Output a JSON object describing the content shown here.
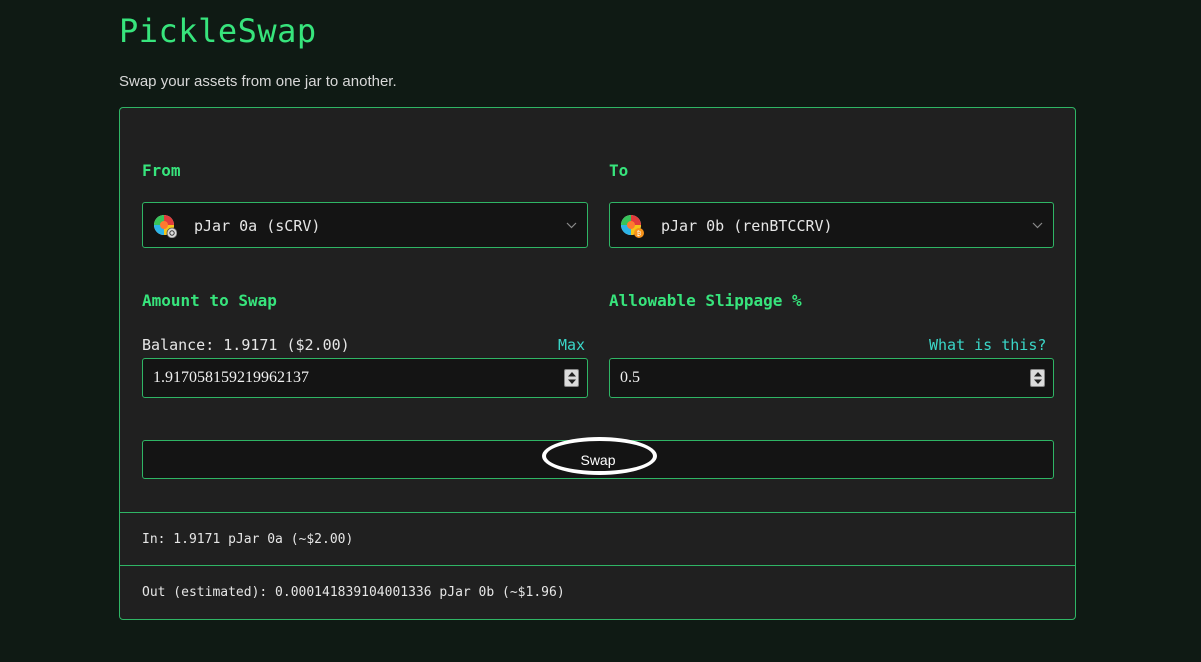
{
  "header": {
    "title": "PickleSwap",
    "subtitle": "Swap your assets from one jar to another."
  },
  "from": {
    "label": "From",
    "selected": "pJar 0a (sCRV)",
    "icon": "jar-scrv-icon"
  },
  "to": {
    "label": "To",
    "selected": "pJar 0b (renBTCCRV)",
    "icon": "jar-renbtc-icon"
  },
  "amount": {
    "label": "Amount to Swap",
    "balance": "Balance: 1.9171 ($2.00)",
    "max_label": "Max",
    "value": "1.917058159219962137"
  },
  "slippage": {
    "label": "Allowable Slippage %",
    "help_label": "What is this?",
    "value": "0.5"
  },
  "swap_button": {
    "label": "Swap"
  },
  "summary": {
    "in": "In: 1.9171 pJar 0a (~$2.00)",
    "out": "Out (estimated): 0.000141839104001336 pJar 0b (~$1.96)"
  },
  "colors": {
    "accent": "#37e47c",
    "border": "#2fb565",
    "link": "#3ad6c8",
    "background": "#0f1a14",
    "card": "#202020"
  }
}
